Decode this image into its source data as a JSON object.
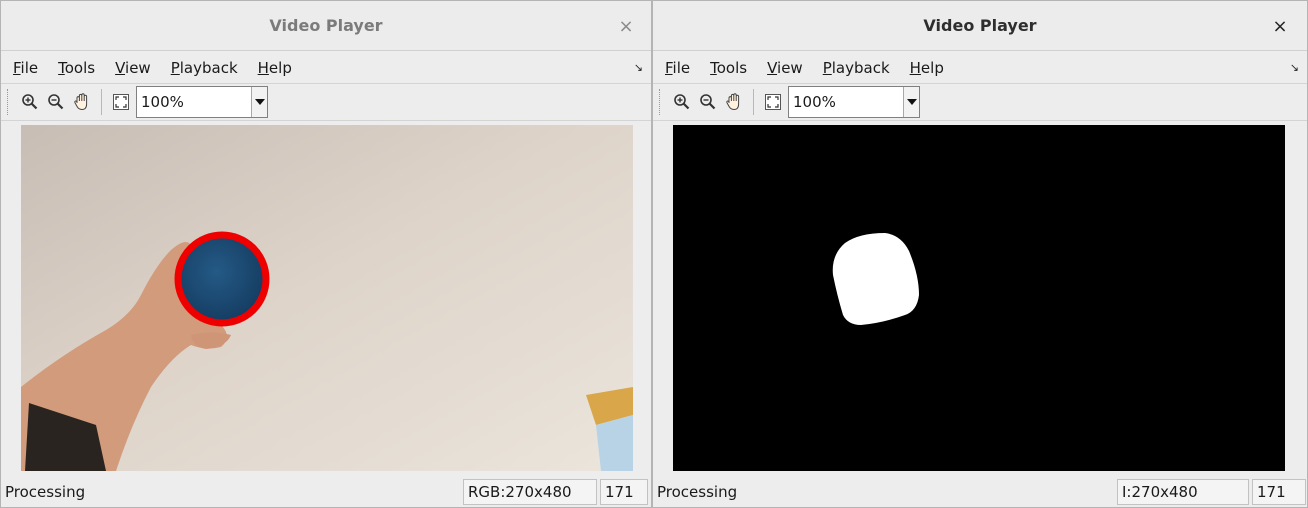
{
  "left_player": {
    "title": "Video Player",
    "close_glyph": "×",
    "menu": [
      {
        "mnemonic": "F",
        "rest": "ile"
      },
      {
        "mnemonic": "T",
        "rest": "ools"
      },
      {
        "mnemonic": "V",
        "rest": "iew"
      },
      {
        "mnemonic": "P",
        "rest": "layback"
      },
      {
        "mnemonic": "H",
        "rest": "elp"
      }
    ],
    "menu_arrow": "↘",
    "zoom_value": "100%",
    "video_description": "hand holding blue ball with red circle",
    "status": "Processing",
    "image_type": "RGB:270x480",
    "frame": "171"
  },
  "right_player": {
    "title": "Video Player",
    "close_glyph": "×",
    "menu": [
      {
        "mnemonic": "F",
        "rest": "ile"
      },
      {
        "mnemonic": "T",
        "rest": "ools"
      },
      {
        "mnemonic": "V",
        "rest": "iew"
      },
      {
        "mnemonic": "P",
        "rest": "layback"
      },
      {
        "mnemonic": "H",
        "rest": "elp"
      }
    ],
    "menu_arrow": "↘",
    "zoom_value": "100%",
    "video_description": "binary mask with white blob",
    "status": "Processing",
    "image_type": "I:270x480",
    "frame": "171"
  },
  "toolbar_icons": [
    "zoom-in-icon",
    "zoom-out-icon",
    "pan-hand-icon",
    "fit-to-window-icon"
  ],
  "colors": {
    "highlight_circle": "#ee0000",
    "ball": "#1d4e7a",
    "mask_background": "#000000",
    "mask_blob": "#ffffff"
  }
}
